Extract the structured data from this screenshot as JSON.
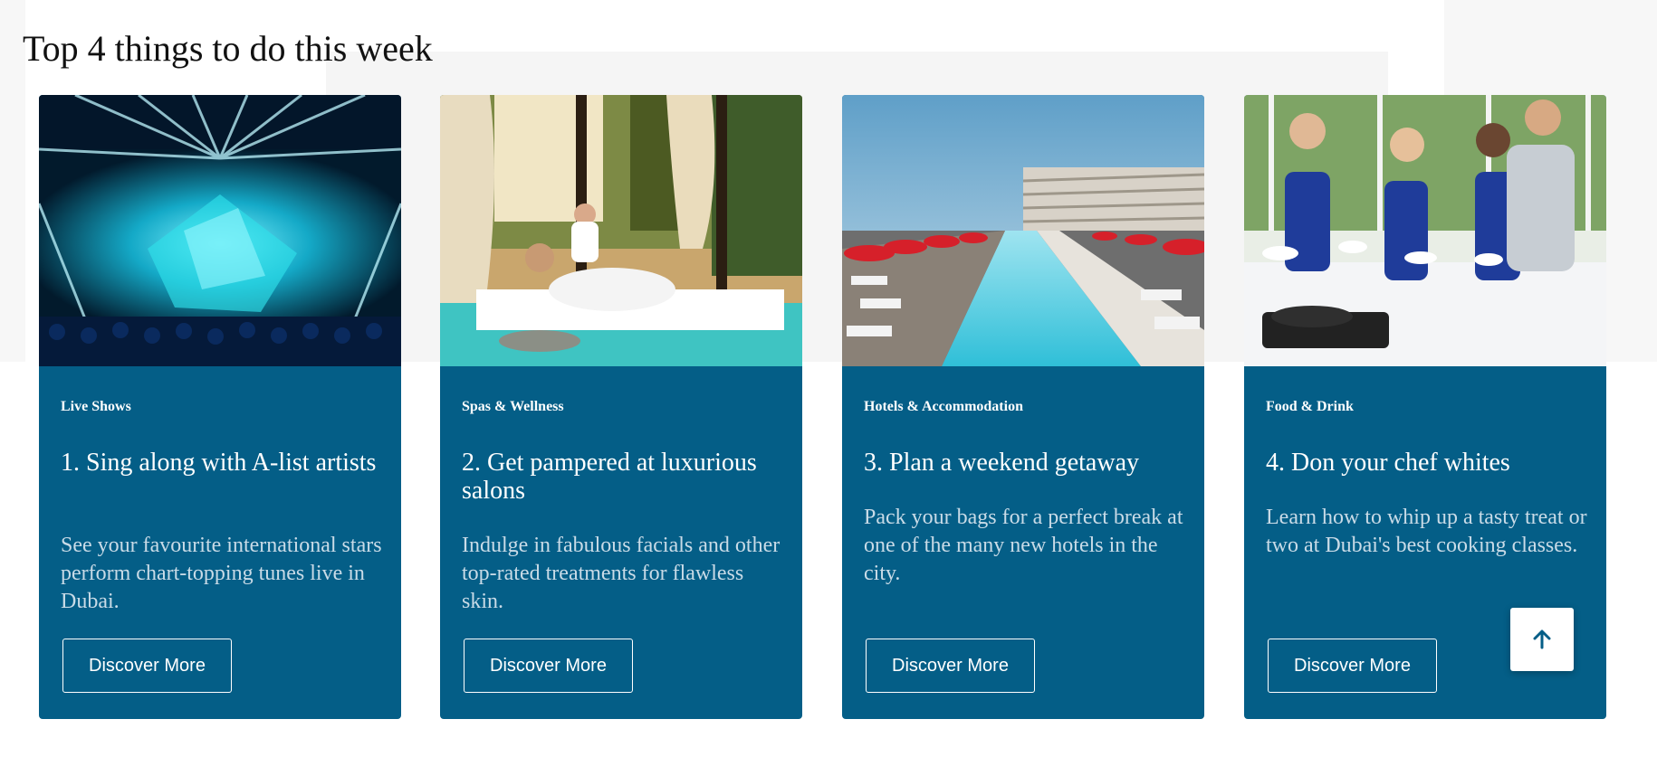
{
  "section": {
    "title": "Top 4 things to do this week"
  },
  "cards": [
    {
      "category": "Live Shows",
      "title": "1. Sing along with A-list artists",
      "description": "See your favourite international stars perform chart-topping tunes live in Dubai.",
      "button_label": "Discover More",
      "image": "concert-stage"
    },
    {
      "category": "Spas & Wellness",
      "title": "2. Get pampered at luxurious salons",
      "description": "Indulge in fabulous facials and other top-rated treatments for flawless skin.",
      "button_label": "Discover More",
      "image": "spa-cabana"
    },
    {
      "category": "Hotels & Accommodation",
      "title": "3. Plan a weekend getaway",
      "description": "Pack your bags for a perfect break at one of the many new hotels in the city.",
      "button_label": "Discover More",
      "image": "hotel-pool"
    },
    {
      "category": "Food & Drink",
      "title": "4. Don your chef whites",
      "description": "Learn how to whip up a tasty treat or two at Dubai's best cooking classes.",
      "button_label": "Discover More",
      "image": "cooking-class"
    }
  ],
  "scroll_top": {
    "icon": "arrow-up-icon"
  },
  "colors": {
    "card_background": "#045e87",
    "card_text": "#ffffff",
    "description_text": "#c9dbe7",
    "accent": "#045e87"
  }
}
